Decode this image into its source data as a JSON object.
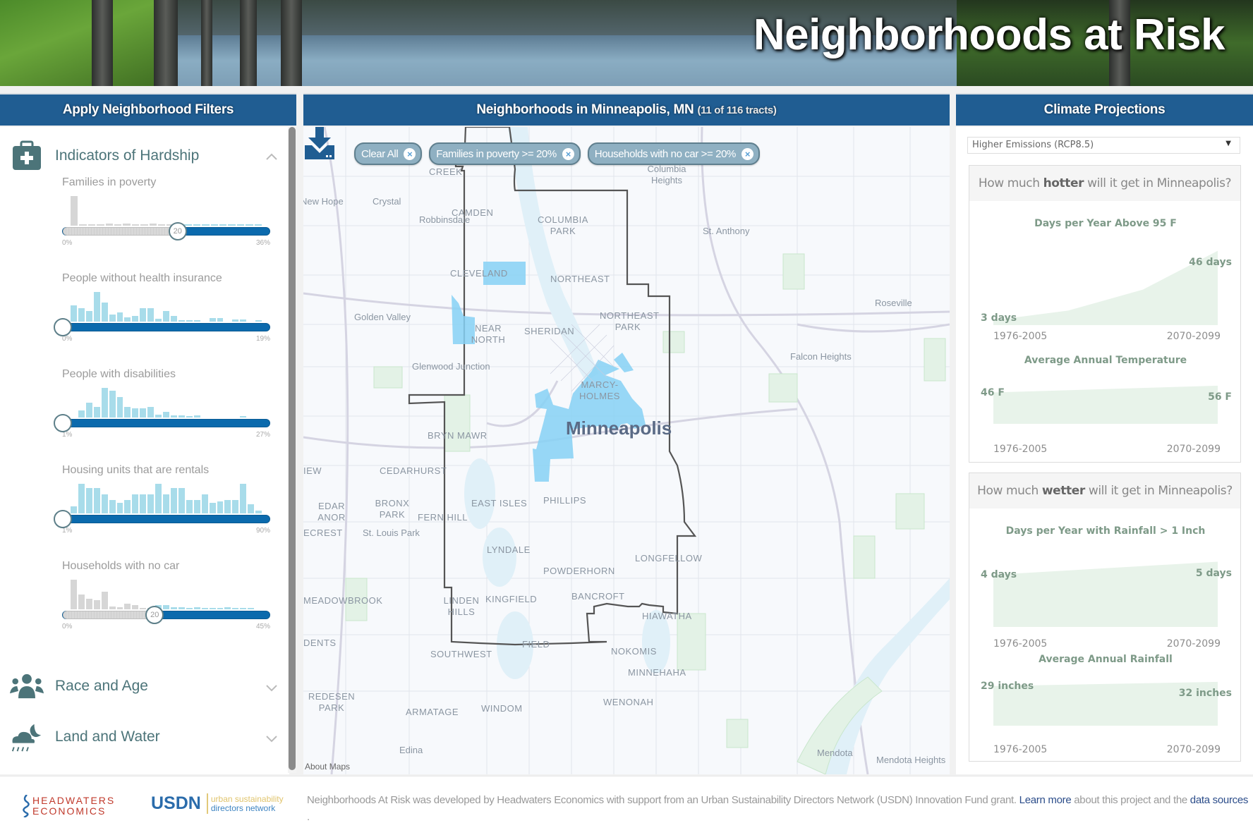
{
  "banner": {
    "title": "Neighborhoods at Risk"
  },
  "left_panel": {
    "header": "Apply Neighborhood Filters",
    "sections": [
      {
        "label": "Indicators of Hardship",
        "icon": "medical-kit-icon",
        "expanded": true
      },
      {
        "label": "Race and Age",
        "icon": "people-group-icon",
        "expanded": false
      },
      {
        "label": "Land and Water",
        "icon": "cloud-moon-rain-icon",
        "expanded": false
      }
    ],
    "filters": [
      {
        "label": "Families in poverty",
        "min_label": "0%",
        "max_label": "36%",
        "min": 0,
        "max": 36,
        "value": 20,
        "knob_label": "20",
        "histogram": [
          10,
          0.3,
          0.3,
          0.3,
          0.6,
          0.3,
          0.6,
          0.3,
          0.2,
          0.6,
          0.2,
          0.2,
          0.3,
          0.5,
          0.3,
          0.3,
          0.3,
          0.2,
          0.1,
          0.1,
          0.05,
          0.05
        ]
      },
      {
        "label": "People without health insurance",
        "min_label": "0%",
        "max_label": "19%",
        "min": 0,
        "max": 19,
        "value": 0,
        "knob_label": "",
        "histogram": [
          5.5,
          4.5,
          3.5,
          10,
          6.5,
          2.5,
          3,
          1.5,
          2,
          4.5,
          4.5,
          1,
          3.5,
          2,
          0.2,
          0.2,
          0.2,
          0,
          1.2,
          1.2,
          0,
          0.8,
          0.8,
          0,
          0.2
        ]
      },
      {
        "label": "People with disabilities",
        "min_label": "1%",
        "max_label": "27%",
        "min": 1,
        "max": 27,
        "value": 1,
        "knob_label": "",
        "histogram": [
          0,
          2.5,
          5,
          3.5,
          10,
          9,
          7,
          3.5,
          3,
          3,
          3.5,
          1,
          1.8,
          0.8,
          0.8,
          0.2,
          0.8,
          0,
          0,
          0,
          0,
          0,
          0.2,
          0,
          0
        ]
      },
      {
        "label": "Housing units that are rentals",
        "min_label": "1%",
        "max_label": "90%",
        "min": 1,
        "max": 90,
        "value": 1,
        "knob_label": "",
        "histogram": [
          2.5,
          10,
          8.5,
          8.5,
          6.5,
          4.5,
          3.5,
          4.5,
          6.5,
          6.5,
          6.5,
          10,
          6.5,
          8.5,
          8.5,
          4.5,
          4.5,
          6.5,
          3.5,
          4,
          4.5,
          4.5,
          10,
          3,
          1
        ]
      },
      {
        "label": "Households with no car",
        "min_label": "0%",
        "max_label": "45%",
        "min": 0,
        "max": 45,
        "value": 20,
        "knob_label": "20",
        "histogram": [
          10,
          5,
          3.5,
          3,
          6,
          1,
          0.7,
          2,
          1.5,
          0.5,
          0.5,
          1.5,
          1.5,
          0.6,
          0.8,
          0.2,
          0.6,
          0.2,
          0.2,
          0.2,
          0.6,
          0.2,
          0.2,
          0.5,
          0
        ]
      }
    ]
  },
  "map_panel": {
    "header": "Neighborhoods in Minneapolis, MN",
    "header_sub": "(11 of 116 tracts)",
    "chips": [
      {
        "label": "Clear All"
      },
      {
        "label": "Families in poverty >= 20%"
      },
      {
        "label": "Households with no car >= 20%"
      }
    ],
    "chip_close_glyph": "×",
    "download_icon": "download-icon",
    "city_label": "Minneapolis",
    "neighborhood_labels": [
      "CREEK",
      "CAMDEN",
      "COLUMBIA PARK",
      "CLEVELAND",
      "NORTHEAST",
      "NORTHEAST PARK",
      "SHERIDAN",
      "NEAR NORTH",
      "MARCY-HOLMES",
      "BRYN MAWR",
      "CEDARHURST",
      "EAST ISLES",
      "BRONX PARK",
      "FERN HILL",
      "PHILLIPS",
      "LYNDALE",
      "LONGFELLOW",
      "POWDERHORN",
      "KINGFIELD",
      "BANCROFT",
      "LINDEN HILLS",
      "MEADOWBROOK",
      "HIAWATHA",
      "FIELD",
      "NOKOMIS",
      "SOUTHWEST",
      "MINNEHAHA",
      "WENONAH",
      "ARMATAGE",
      "WINDOM",
      "IEW",
      "EDAR ANOR",
      "ECREST",
      "DENTS",
      "REDESEN PARK"
    ],
    "town_labels": [
      "Columbia Heights",
      "New Hope",
      "Crystal",
      "Robbinsdale",
      "St. Anthony",
      "Roseville",
      "Golden Valley",
      "Glenwood Junction",
      "Falcon Heights",
      "St. Louis Park",
      "Edina",
      "Mendota",
      "Mendota Heights"
    ],
    "attribution": "About Maps",
    "highlight_color": "#88d3f5"
  },
  "right_panel": {
    "header": "Climate Projections",
    "scenario": "Higher Emissions (RCP8.5)",
    "cards": [
      {
        "question_pre": "How much",
        "question_bold": "hotter",
        "question_post": "will it get in Minneapolis?"
      },
      {
        "question_pre": "How much",
        "question_bold": "wetter",
        "question_post": "will it get in Minneapolis?"
      }
    ]
  },
  "chart_data": [
    {
      "type": "area",
      "title": "Days per Year Above 95 F",
      "x": [
        "1976-2005",
        "2070-2099"
      ],
      "values": [
        3,
        46
      ],
      "labels": [
        "3 days",
        "46 days"
      ],
      "ylim": [
        0,
        48
      ],
      "curve": [
        3,
        9,
        22,
        46
      ],
      "grid": false
    },
    {
      "type": "area",
      "title": "Average Annual Temperature",
      "x": [
        "1976-2005",
        "2070-2099"
      ],
      "values": [
        46,
        56
      ],
      "labels": [
        "46 F",
        "56 F"
      ],
      "ylim": [
        0,
        60
      ],
      "curve": [
        46,
        56
      ],
      "grid": false
    },
    {
      "type": "area",
      "title": "Days per Year with Rainfall > 1 Inch",
      "x": [
        "1976-2005",
        "2070-2099"
      ],
      "values": [
        4,
        5
      ],
      "labels": [
        "4 days",
        "5 days"
      ],
      "ylim": [
        0,
        5.3
      ],
      "curve": [
        4,
        5
      ],
      "grid": false
    },
    {
      "type": "area",
      "title": "Average Annual Rainfall",
      "x": [
        "1976-2005",
        "2070-2099"
      ],
      "values": [
        29,
        32
      ],
      "labels": [
        "29 inches",
        "32 inches"
      ],
      "ylim": [
        0,
        33
      ],
      "curve": [
        29,
        32
      ],
      "grid": false
    }
  ],
  "footer": {
    "logo1_line1": "HEADWATERS",
    "logo1_line2": "ECONOMICS",
    "logo2_big": "USDN",
    "logo2_line1": "urban sustainability",
    "logo2_line2": "directors network",
    "text_1": "Neighborhoods At Risk was developed by Headwaters Economics with support from an Urban Sustainability Directors Network (USDN) Innovation Fund grant.",
    "link_1": "Learn more",
    "text_2": "about this project and the",
    "link_2": "data sources",
    "text_3": "."
  }
}
